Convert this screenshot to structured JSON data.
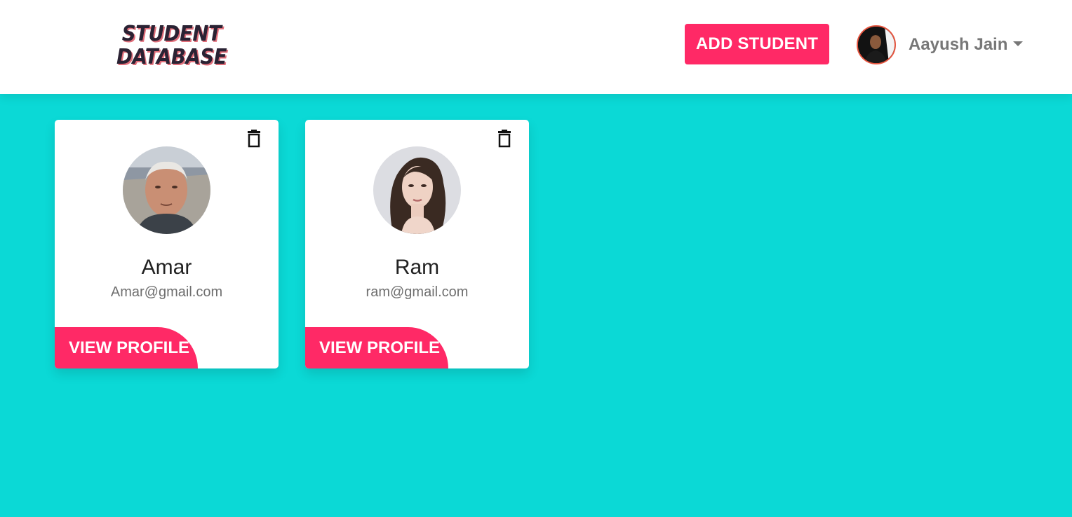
{
  "header": {
    "logo_line1": "STUDENT",
    "logo_line2": "DATABASE",
    "add_button": "ADD STUDENT",
    "user_name": "Aayush Jain"
  },
  "colors": {
    "accent": "#ff2966",
    "background": "#0bd9d6",
    "card": "#ffffff"
  },
  "students": [
    {
      "name": "Amar",
      "email": "Amar@gmail.com",
      "button": "VIEW PROFILE",
      "delete_icon": "trash-icon"
    },
    {
      "name": "Ram",
      "email": "ram@gmail.com",
      "button": "VIEW PROFILE",
      "delete_icon": "trash-icon"
    }
  ]
}
